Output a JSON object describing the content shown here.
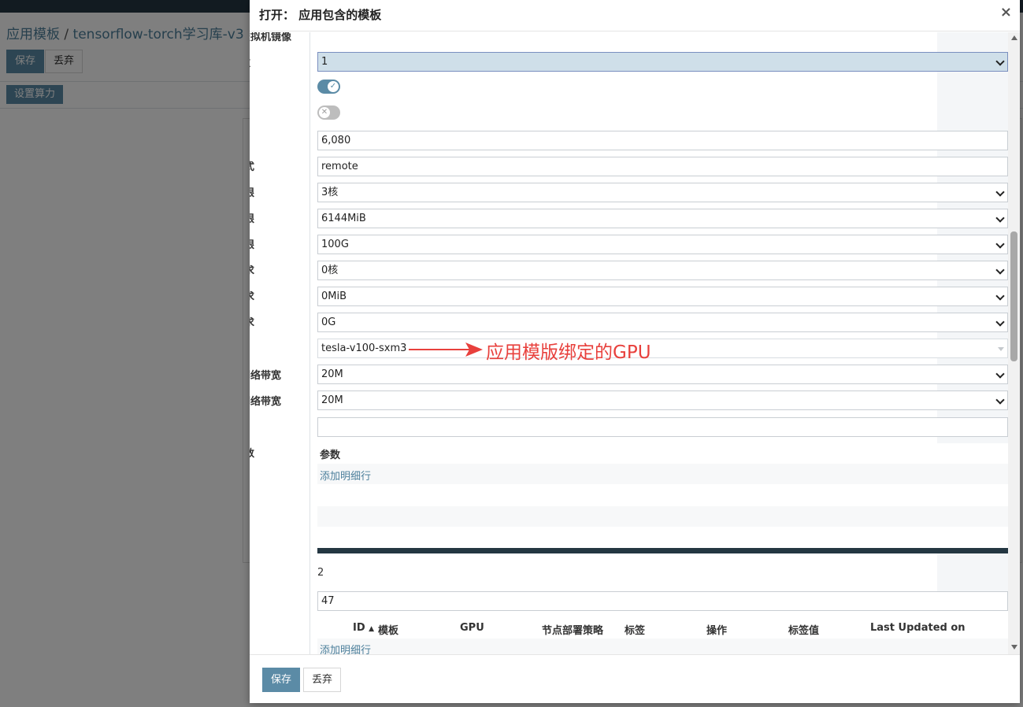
{
  "background": {
    "breadcrumb_parent": "应用模板",
    "breadcrumb_sep": "/",
    "breadcrumb_current": "tensorflow-torch学习库-v3",
    "save_label": "保存",
    "discard_label": "丢弃",
    "set_compute_label": "设置算力"
  },
  "modal": {
    "title": "打开： 应用包含的模板",
    "close_glyph": "×",
    "labels": {
      "image": "虚拟机镜像",
      "count": "数",
      "mode": "式",
      "cpu_limit": "限",
      "mem_limit": "限",
      "disk_limit": "限",
      "cpu_req": "求",
      "mem_req": "求",
      "disk_req": "求",
      "in_bandwidth": "网络带宽",
      "out_bandwidth": "网络带宽",
      "params": "数"
    },
    "fields": {
      "count": "1",
      "port": "6,080",
      "mode": "remote",
      "cpu_limit": "3核",
      "mem_limit": "6144MiB",
      "disk_limit": "100G",
      "cpu_req": "0核",
      "mem_req": "0MiB",
      "disk_req": "0G",
      "gpu": "tesla-v100-sxm3",
      "in_bandwidth": "20M",
      "out_bandwidth": "20M",
      "extra": ""
    },
    "toggle_on_glyph": "✓",
    "toggle_off_glyph": "✕",
    "annotation": "应用模版绑定的GPU",
    "params_title": "参数",
    "add_line_label": "添加明细行",
    "count_value": "2",
    "number_value": "47",
    "table": {
      "headers": [
        "ID",
        "模板",
        "GPU",
        "节点部署策略",
        "标签",
        "操作",
        "标签值",
        "Last Updated on"
      ],
      "sort_glyph": "▲"
    },
    "add_line_label_2": "添加明细行",
    "footer": {
      "save_label": "保存",
      "discard_label": "丢弃"
    }
  },
  "colors": {
    "primary": "#5b8ba6",
    "annotation": "#e8403c",
    "dark": "#243742"
  }
}
